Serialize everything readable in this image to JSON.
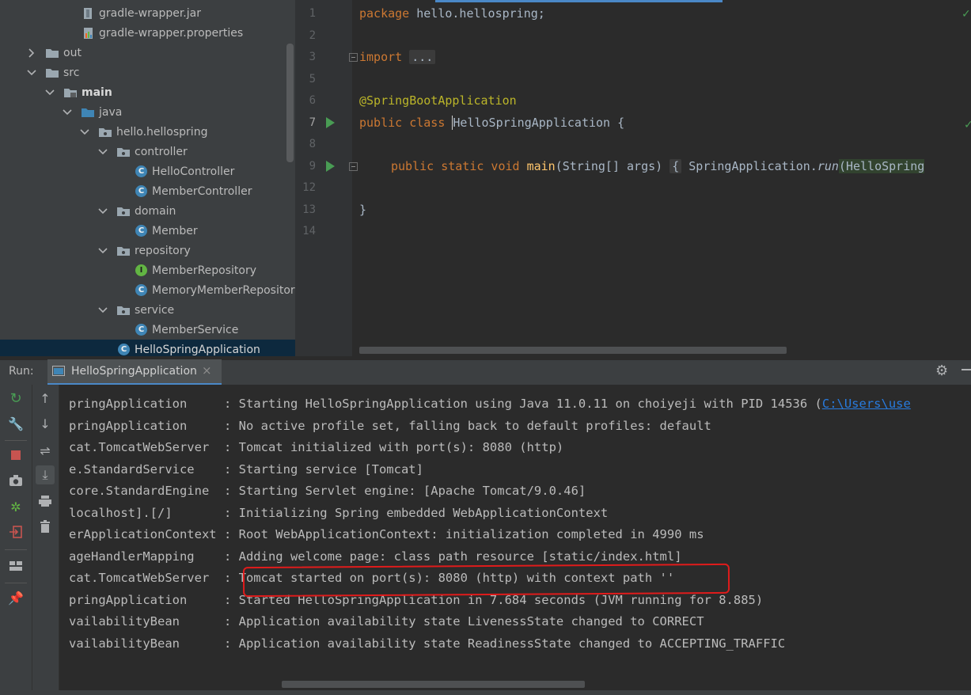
{
  "project_tree": {
    "items": [
      {
        "label": "gradle-wrapper.jar",
        "icon": "jar-file-icon"
      },
      {
        "label": "gradle-wrapper.properties",
        "icon": "properties-file-icon"
      },
      {
        "label": "out",
        "icon": "folder-icon"
      },
      {
        "label": "src",
        "icon": "folder-icon"
      },
      {
        "label": "main",
        "icon": "source-folder-icon"
      },
      {
        "label": "java",
        "icon": "source-root-folder-icon"
      },
      {
        "label": "hello.hellospring",
        "icon": "package-icon"
      },
      {
        "label": "controller",
        "icon": "package-icon"
      },
      {
        "label": "HelloController",
        "icon": "class-icon",
        "badge": "C"
      },
      {
        "label": "MemberController",
        "icon": "class-icon",
        "badge": "C"
      },
      {
        "label": "domain",
        "icon": "package-icon"
      },
      {
        "label": "Member",
        "icon": "class-icon",
        "badge": "C"
      },
      {
        "label": "repository",
        "icon": "package-icon"
      },
      {
        "label": "MemberRepository",
        "icon": "interface-icon",
        "badge": "I"
      },
      {
        "label": "MemoryMemberRepository",
        "icon": "class-icon",
        "badge": "C"
      },
      {
        "label": "service",
        "icon": "package-icon"
      },
      {
        "label": "MemberService",
        "icon": "class-icon",
        "badge": "C"
      },
      {
        "label": "HelloSpringApplication",
        "icon": "spring-boot-class-icon",
        "badge": "C"
      }
    ]
  },
  "editor": {
    "line_numbers": [
      "1",
      "2",
      "3",
      "5",
      "6",
      "7",
      "8",
      "9",
      "12",
      "13",
      "14"
    ],
    "line1": {
      "kw": "package",
      "text": " hello.hellospring;"
    },
    "line3": {
      "kw": "import",
      "fold": "..."
    },
    "line6": {
      "annotation": "@SpringBootApplication"
    },
    "line7": {
      "kw": "public class",
      "class_name": "HelloSpringApplication",
      "rest": " {"
    },
    "line9": {
      "kw": "public static void",
      "method": "main",
      "params": "(String[] args)",
      "brace": "{",
      "call_class": "SpringApplication.",
      "call_method": "run",
      "call_arg": "(HelloSpring"
    },
    "line13": {
      "text": "}"
    }
  },
  "run_window": {
    "label": "Run:",
    "tab_label": "HelloSpringApplication",
    "tab_close": "×"
  },
  "console": {
    "lines": [
      {
        "logger": "pringApplication     ",
        "message": "Starting HelloSpringApplication using Java 11.0.11 on choiyeji with PID 14536 (",
        "link": "C:\\Users\\use"
      },
      {
        "logger": "pringApplication     ",
        "message": "No active profile set, falling back to default profiles: default"
      },
      {
        "logger": "cat.TomcatWebServer  ",
        "message": "Tomcat initialized with port(s): 8080 (http)"
      },
      {
        "logger": "e.StandardService    ",
        "message": "Starting service [Tomcat]"
      },
      {
        "logger": "core.StandardEngine  ",
        "message": "Starting Servlet engine: [Apache Tomcat/9.0.46]"
      },
      {
        "logger": "localhost].[/]       ",
        "message": "Initializing Spring embedded WebApplicationContext"
      },
      {
        "logger": "erApplicationContext ",
        "message": "Root WebApplicationContext: initialization completed in 4990 ms"
      },
      {
        "logger": "ageHandlerMapping    ",
        "message": "Adding welcome page: class path resource [static/index.html]"
      },
      {
        "logger": "cat.TomcatWebServer  ",
        "message": "Tomcat started on port(s): 8080 (http) with context path ''"
      },
      {
        "logger": "pringApplication     ",
        "message": "Started HelloSpringApplication in 7.684 seconds (JVM running for 8.885)"
      },
      {
        "logger": "vailabilityBean      ",
        "message": "Application availability state LivenessState changed to CORRECT"
      },
      {
        "logger": "vailabilityBean      ",
        "message": "Application availability state ReadinessState changed to ACCEPTING_TRAFFIC"
      }
    ]
  },
  "colors": {
    "keyword": "#cc7832",
    "annotation": "#bbb529",
    "method": "#ffc66d",
    "highlight_box": "#e01b1b",
    "link": "#287bde"
  }
}
